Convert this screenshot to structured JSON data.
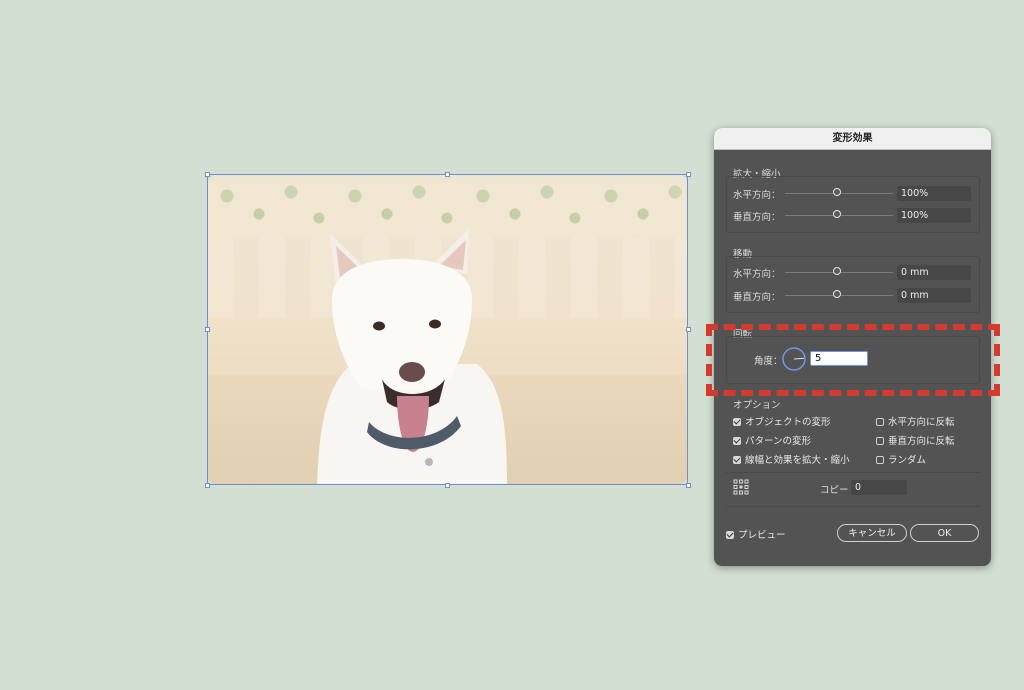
{
  "dialog": {
    "title": "変形効果",
    "scale": {
      "label": "拡大・縮小",
      "horizontal": {
        "label": "水平方向：",
        "value": "100%"
      },
      "vertical": {
        "label": "垂直方向：",
        "value": "100%"
      }
    },
    "move": {
      "label": "移動",
      "horizontal": {
        "label": "水平方向：",
        "value": "0 mm"
      },
      "vertical": {
        "label": "垂直方向：",
        "value": "0 mm"
      }
    },
    "rotate": {
      "label": "回転",
      "angle_label": "角度：",
      "angle_value": "5"
    },
    "options": {
      "label": "オプション",
      "transform_objects": "オブジェクトの変形",
      "transform_patterns": "パターンの変形",
      "scale_strokes": "線幅と効果を拡大・縮小",
      "reflect_x": "水平方向に反転",
      "reflect_y": "垂直方向に反転",
      "random": "ランダム"
    },
    "copies": {
      "label": "コピー",
      "value": "0"
    },
    "preview_label": "プレビュー",
    "cancel_label": "キャンセル",
    "ok_label": "OK"
  },
  "colors": {
    "canvas_bg": "#d2dfd2",
    "dialog_bg": "#535353",
    "highlight": "#d43a2e",
    "selection": "#6f8fcf"
  }
}
